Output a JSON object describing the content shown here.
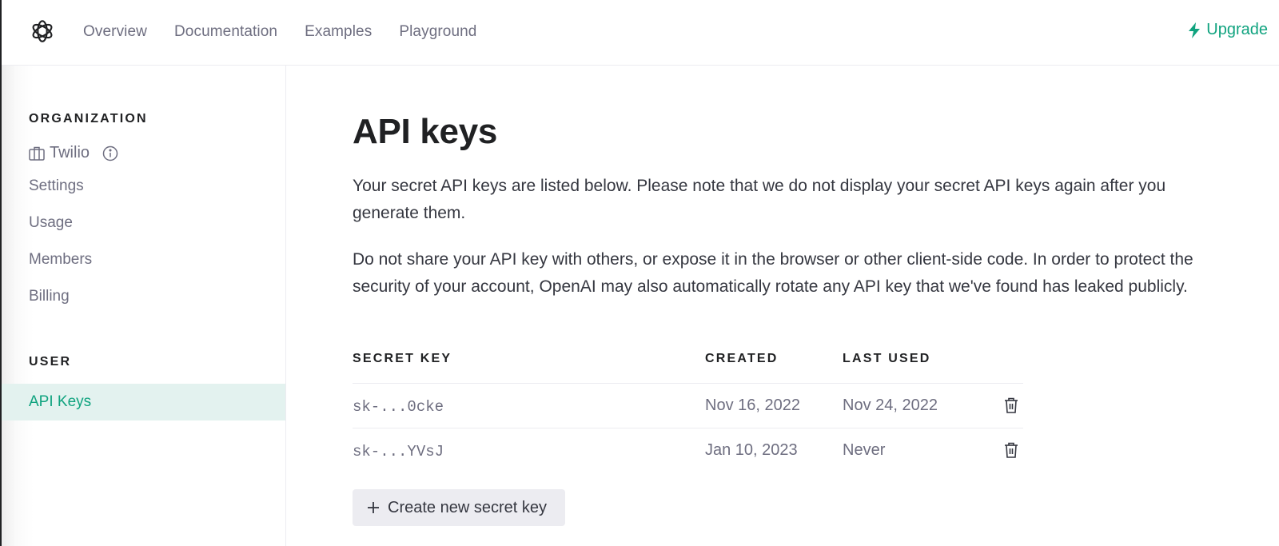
{
  "topbar": {
    "logo": "openai-logo-icon",
    "nav": [
      "Overview",
      "Documentation",
      "Examples",
      "Playground"
    ],
    "upgrade_label": "Upgrade",
    "upgrade_icon": "lightning-bolt-icon",
    "accent_color": "#10a37f"
  },
  "sidebar": {
    "organization_label": "ORGANIZATION",
    "org_name": "Twilio",
    "org_icon": "briefcase-icon",
    "org_info_icon": "info-circle-icon",
    "org_items": [
      "Settings",
      "Usage",
      "Members",
      "Billing"
    ],
    "user_label": "USER",
    "user_items": [
      {
        "label": "API Keys",
        "active": true
      }
    ],
    "active_bg": "#e3f2ef"
  },
  "main": {
    "title": "API keys",
    "paragraphs": [
      "Your secret API keys are listed below. Please note that we do not display your secret API keys again after you generate them.",
      "Do not share your API key with others, or expose it in the browser or other client-side code. In order to protect the security of your account, OpenAI may also automatically rotate any API key that we've found has leaked publicly."
    ],
    "table": {
      "headers": [
        "SECRET KEY",
        "CREATED",
        "LAST USED"
      ],
      "rows": [
        {
          "key": "sk-...0cke",
          "created": "Nov 16, 2022",
          "last_used": "Nov 24, 2022",
          "action_icon": "trash-icon"
        },
        {
          "key": "sk-...YVsJ",
          "created": "Jan 10, 2023",
          "last_used": "Never",
          "action_icon": "trash-icon"
        }
      ]
    },
    "create_button": {
      "icon": "plus-icon",
      "label": "Create new secret key"
    }
  }
}
